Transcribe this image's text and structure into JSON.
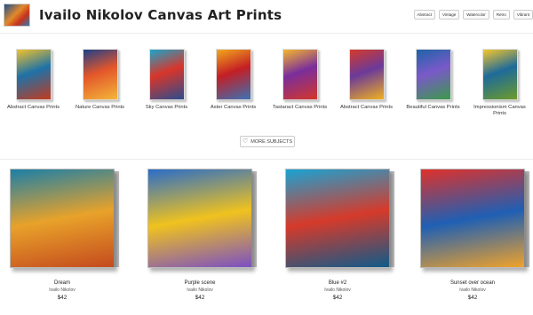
{
  "header": {
    "title": "Ivailo Nikolov Canvas Art Prints",
    "avatar_icon": "canvas-art-thumbnail",
    "chips": [
      "Abstract",
      "Vintage",
      "Watercolor",
      "Retro",
      "Vibrant"
    ]
  },
  "subjects": [
    {
      "label": "Abstract Canvas Prints",
      "colors": [
        "#f2c22a",
        "#1e72a8",
        "#c23a1e"
      ]
    },
    {
      "label": "Nature Canvas Prints",
      "colors": [
        "#1d3f8a",
        "#e3562a",
        "#f4b63a"
      ]
    },
    {
      "label": "Sky Canvas Prints",
      "colors": [
        "#1aa6c9",
        "#d8352a",
        "#2b4d8e"
      ]
    },
    {
      "label": "Aster Canvas Prints",
      "colors": [
        "#f2a81d",
        "#c41e24",
        "#3a73b5"
      ]
    },
    {
      "label": "Tastaract Canvas Prints",
      "colors": [
        "#f5b62d",
        "#7a2e9c",
        "#d4362a"
      ]
    },
    {
      "label": "Abstract Canvas Prints",
      "colors": [
        "#d43a2a",
        "#6b3a9a",
        "#f0b020"
      ]
    },
    {
      "label": "Beautiful Canvas Prints",
      "colors": [
        "#1f64a8",
        "#7a59c9",
        "#3b9a4a"
      ]
    },
    {
      "label": "Impressionism Canvas Prints",
      "colors": [
        "#f5c72b",
        "#1e6a9a",
        "#6e9b2a"
      ]
    }
  ],
  "more_button": {
    "label": "MORE SUBJECTS",
    "icon": "heart-icon"
  },
  "products": [
    {
      "title": "Dream",
      "artist": "Ivailo Nikolov",
      "price": "$42",
      "colors": [
        "#1b7fa8",
        "#e8a22a",
        "#c44a1e"
      ]
    },
    {
      "title": "Purple scene",
      "artist": "Ivailo Nikolov",
      "price": "$42",
      "colors": [
        "#2a6dc9",
        "#f0c21e",
        "#7b4fc4"
      ]
    },
    {
      "title": "Blue #2",
      "artist": "Ivailo Nikolov",
      "price": "$42",
      "colors": [
        "#1aa3d4",
        "#d63a2a",
        "#0f5a8a"
      ]
    },
    {
      "title": "Sunset over ocean",
      "artist": "Ivailo Nikolov",
      "price": "$42",
      "colors": [
        "#e0312a",
        "#1f5fb4",
        "#f0a22a"
      ]
    }
  ]
}
